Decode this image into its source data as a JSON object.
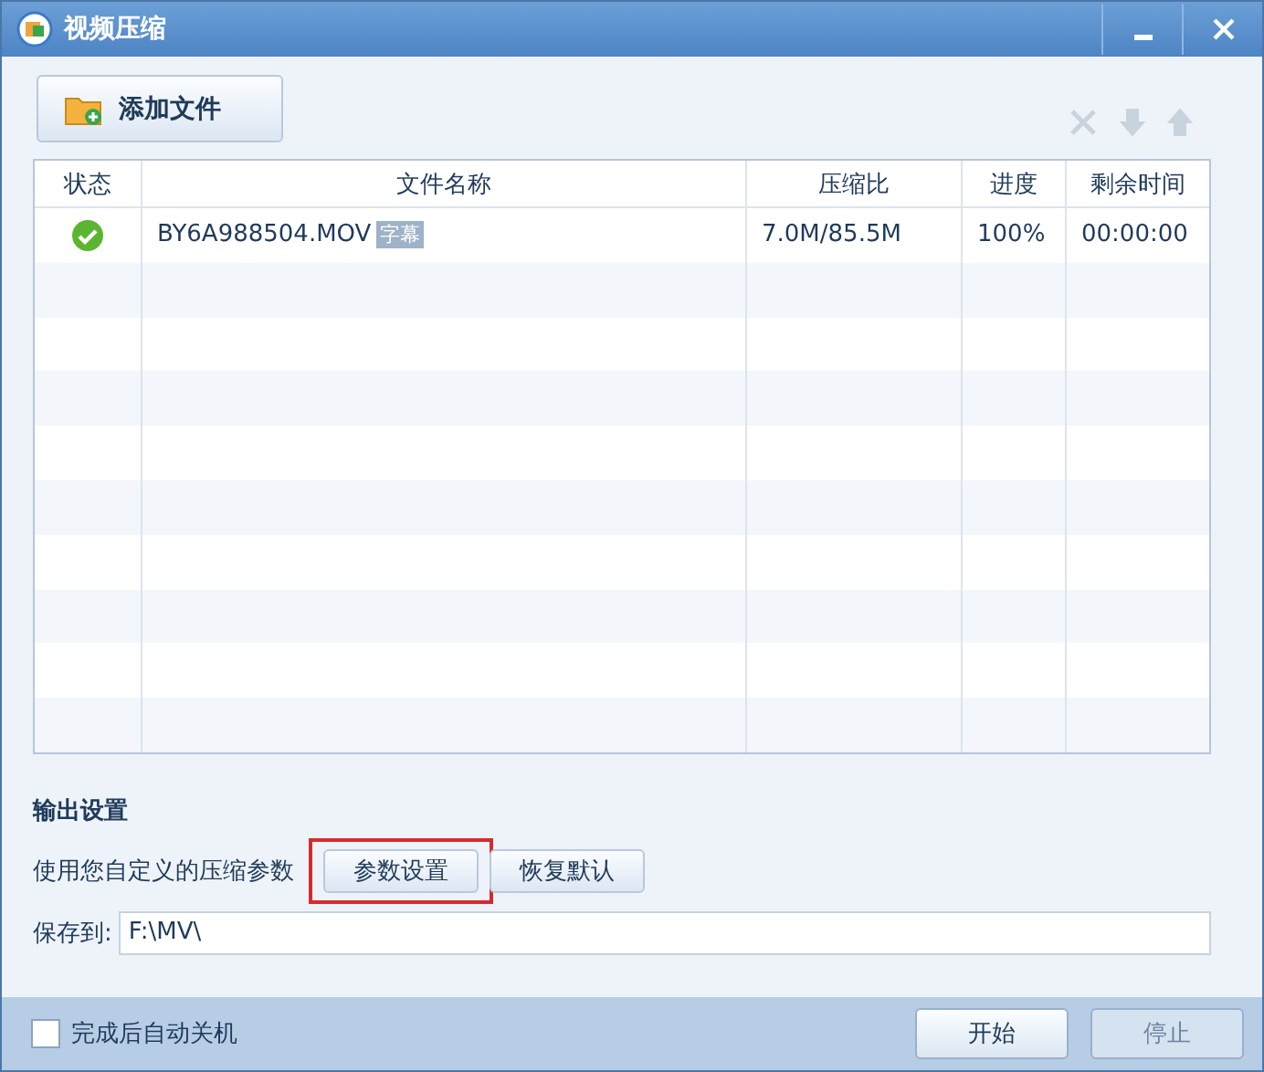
{
  "window": {
    "title": "视频压缩"
  },
  "add_button": {
    "label": "添加文件"
  },
  "toolbar": [
    {
      "kind": "delete",
      "disabled": true
    },
    {
      "kind": "down",
      "disabled": true
    },
    {
      "kind": "up",
      "disabled": true
    }
  ],
  "table": {
    "columns": [
      "状态",
      "文件名称",
      "压缩比",
      "进度",
      "剩余时间"
    ],
    "rows": [
      {
        "kind": "done",
        "filename": "BY6A988504.MOV",
        "tag": "字幕",
        "ratio": "7.0M/85.5M",
        "progress": "100%",
        "remaining": "00:00:00"
      }
    ]
  },
  "output": {
    "heading": "输出设置",
    "description": "使用您自定义的压缩参数",
    "buttons": [
      {
        "label": "参数设置",
        "highlighted": true
      },
      {
        "label": "恢复默认",
        "highlighted": false
      }
    ],
    "save_label": "保存到:",
    "save_path": "F:\\MV\\"
  },
  "shutdown": {
    "label": "完成后自动关机",
    "checked": false
  },
  "actions": [
    {
      "label": "开始",
      "disabled": false
    },
    {
      "label": "停止",
      "disabled": true
    }
  ]
}
